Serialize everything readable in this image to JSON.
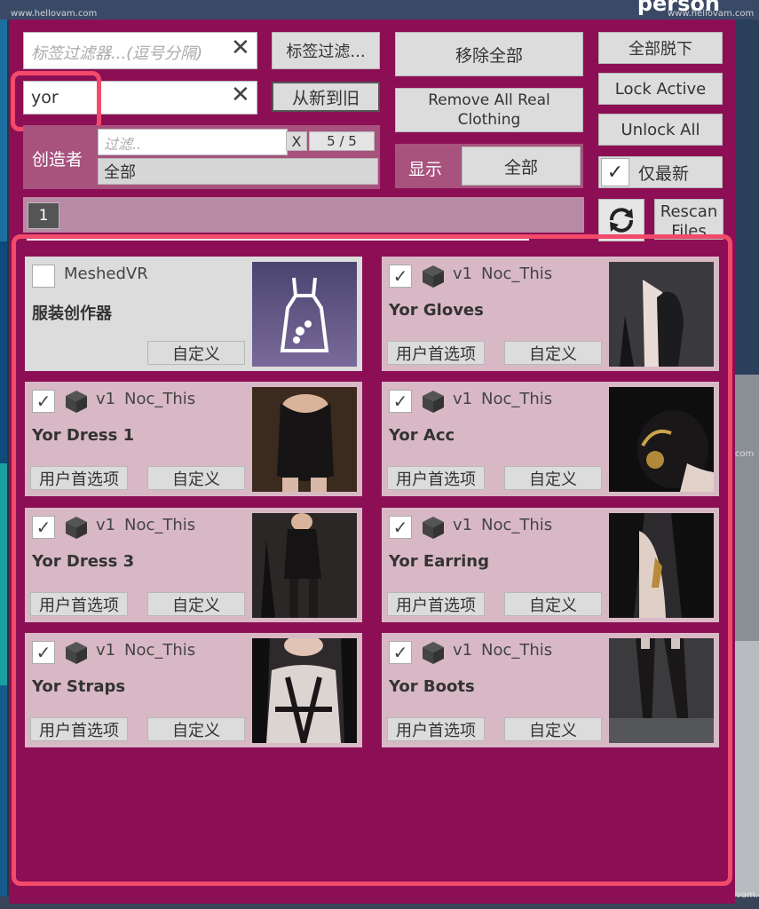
{
  "header": {
    "title": "person"
  },
  "watermark": "www.hellovam.com",
  "filters": {
    "tag_filter_placeholder": "标签过滤器...(逗号分隔)",
    "tag_filter_button": "标签过滤...",
    "search_value": "yor",
    "sort_button": "从新到旧",
    "creator_label": "创造者",
    "creator_filter_placeholder": "过滤..",
    "creator_clear": "X",
    "creator_count": "5 / 5",
    "creator_selected": "全部"
  },
  "actions": {
    "remove_all": "移除全部",
    "remove_all_real_clothing": "Remove All Real Clothing",
    "undress_all": "全部脱下",
    "lock_active": "Lock Active",
    "unlock_all": "Unlock All",
    "show_label": "显示",
    "show_value": "全部",
    "latest_only_label": "仅最新",
    "latest_only_checked": true,
    "rescan_files": "Rescan Files"
  },
  "pagination": {
    "current_page": "1"
  },
  "items": [
    {
      "title": "服装创作器",
      "creator": "MeshedVR",
      "version": "",
      "checked": false,
      "custom_label": "自定义",
      "user_pref_label": "",
      "thumb": "dress-creator-icon"
    },
    {
      "title": "Yor Gloves",
      "creator": "Noc_This",
      "version": "v1",
      "checked": true,
      "custom_label": "自定义",
      "user_pref_label": "用户首选项",
      "thumb": "gloves"
    },
    {
      "title": "Yor Dress 1",
      "creator": "Noc_This",
      "version": "v1",
      "checked": true,
      "custom_label": "自定义",
      "user_pref_label": "用户首选项",
      "thumb": "dress1"
    },
    {
      "title": "Yor Acc",
      "creator": "Noc_This",
      "version": "v1",
      "checked": true,
      "custom_label": "自定义",
      "user_pref_label": "用户首选项",
      "thumb": "acc"
    },
    {
      "title": "Yor Dress 3",
      "creator": "Noc_This",
      "version": "v1",
      "checked": true,
      "custom_label": "自定义",
      "user_pref_label": "用户首选项",
      "thumb": "dress3"
    },
    {
      "title": "Yor Earring",
      "creator": "Noc_This",
      "version": "v1",
      "checked": true,
      "custom_label": "自定义",
      "user_pref_label": "用户首选项",
      "thumb": "earring"
    },
    {
      "title": "Yor Straps",
      "creator": "Noc_This",
      "version": "v1",
      "checked": true,
      "custom_label": "自定义",
      "user_pref_label": "用户首选项",
      "thumb": "straps"
    },
    {
      "title": "Yor Boots",
      "creator": "Noc_This",
      "version": "v1",
      "checked": true,
      "custom_label": "自定义",
      "user_pref_label": "用户首选项",
      "thumb": "boots"
    }
  ],
  "colors": {
    "panel": "#8c0f55",
    "card": "#d9b8c6",
    "highlight": "#f24a6a"
  }
}
